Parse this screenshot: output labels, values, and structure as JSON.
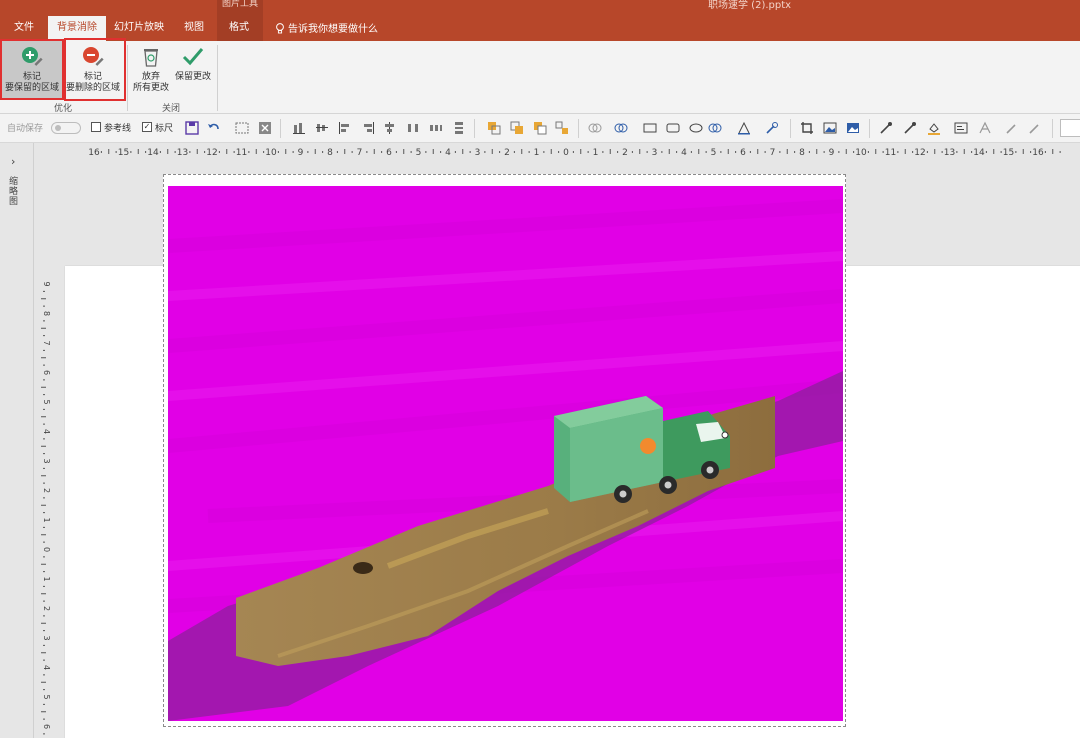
{
  "app": {
    "context_tab_header": "图片工具",
    "document_title": "职场速学 (2).pptx"
  },
  "tabs": [
    {
      "label": "文件"
    },
    {
      "label": "背景消除"
    },
    {
      "label": "幻灯片放映"
    },
    {
      "label": "视图"
    },
    {
      "label": "格式"
    }
  ],
  "tell_me": "告诉我你想要做什么",
  "ribbon": {
    "mark_keep": {
      "line1": "标记",
      "line2": "要保留的区域"
    },
    "mark_remove": {
      "line1": "标记",
      "line2": "要删除的区域"
    },
    "group_refine": "优化",
    "discard": {
      "line1": "放弃",
      "line2": "所有更改"
    },
    "keep_changes": "保留更改",
    "group_close": "关闭"
  },
  "qat": {
    "autosave": "自动保存",
    "guides_label": "参考线",
    "ruler_label": "标尺",
    "ruler_checked": true,
    "guides_checked": false
  },
  "left_pane": {
    "thumbnails_label": "缩略图"
  },
  "ruler": {
    "h_ticks": [
      "16",
      "15",
      "14",
      "13",
      "12",
      "11",
      "10",
      "9",
      "8",
      "7",
      "6",
      "5",
      "4",
      "3",
      "2",
      "1",
      "0",
      "1",
      "2",
      "3",
      "4",
      "5",
      "6",
      "7",
      "8",
      "9",
      "10",
      "11",
      "12",
      "13",
      "14",
      "15",
      "16"
    ],
    "v_ticks": [
      "9",
      "8",
      "7",
      "6",
      "5",
      "4",
      "3",
      "2",
      "1",
      "0",
      "1",
      "2",
      "3",
      "4",
      "5",
      "6"
    ]
  },
  "colors": {
    "brand": "#b7472a",
    "removal_overlay": "#e100e6",
    "highlight": "#e03030"
  },
  "icons": {
    "mark_keep": "plus-circle-pencil-icon",
    "mark_remove": "minus-circle-pencil-icon",
    "discard": "recycle-bin-icon",
    "keep": "checkmark-icon",
    "tell_me": "lightbulb-icon"
  }
}
